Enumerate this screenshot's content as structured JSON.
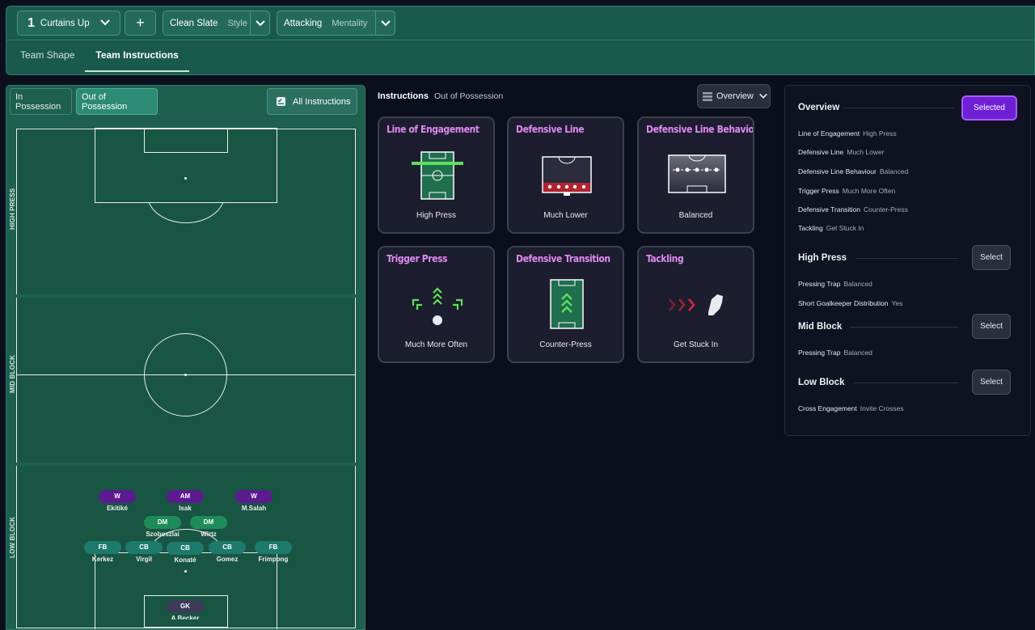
{
  "header": {
    "tactic_number": "1",
    "tactic_name": "Curtains Up",
    "add_label": "+",
    "style": {
      "value": "Clean Slate",
      "label": "Style"
    },
    "mentality": {
      "value": "Attacking",
      "label": "Mentality"
    },
    "tabs": [
      {
        "label": "Team Shape"
      },
      {
        "label": "Team Instructions"
      }
    ]
  },
  "pitch_panel": {
    "toggle_in": "In Possession",
    "toggle_out": "Out of Possession",
    "all_instructions": "All Instructions",
    "zones": [
      "HIGH PRESS",
      "MID BLOCK",
      "LOW BLOCK"
    ],
    "players": [
      {
        "pos": "W",
        "name": "Ekitiké"
      },
      {
        "pos": "AM",
        "name": "Isak"
      },
      {
        "pos": "W",
        "name": "M.Salah"
      },
      {
        "pos": "DM",
        "name": "Szoboszlai"
      },
      {
        "pos": "DM",
        "name": "Wirtz"
      },
      {
        "pos": "FB",
        "name": "Kerkez"
      },
      {
        "pos": "CB",
        "name": "Virgil"
      },
      {
        "pos": "CB",
        "name": "Konaté"
      },
      {
        "pos": "CB",
        "name": "Gomez"
      },
      {
        "pos": "FB",
        "name": "Frimpong"
      },
      {
        "pos": "GK",
        "name": "A.Becker"
      }
    ]
  },
  "instructions": {
    "title": "Instructions",
    "subtitle": "Out of Possession",
    "view_select": "Overview",
    "cards": [
      {
        "title": "Line of Engagement",
        "value": "High Press"
      },
      {
        "title": "Defensive Line",
        "value": "Much Lower"
      },
      {
        "title": "Defensive Line Behavio",
        "value": "Balanced"
      },
      {
        "title": "Trigger Press",
        "value": "Much More Often"
      },
      {
        "title": "Defensive Transition",
        "value": "Counter-Press"
      },
      {
        "title": "Tackling",
        "value": "Get Stuck In"
      }
    ]
  },
  "overview": {
    "title": "Overview",
    "selected_label": "Selected",
    "items": [
      {
        "label": "Line of Engagement",
        "value": "High Press"
      },
      {
        "label": "Defensive Line",
        "value": "Much Lower"
      },
      {
        "label": "Defensive Line Behaviour",
        "value": "Balanced"
      },
      {
        "label": "Trigger Press",
        "value": "Much More Often"
      },
      {
        "label": "Defensive Transition",
        "value": "Counter-Press"
      },
      {
        "label": "Tackling",
        "value": "Get Stuck In"
      }
    ],
    "sections": [
      {
        "title": "High Press",
        "button": "Select",
        "items": [
          {
            "label": "Pressing Trap",
            "value": "Balanced"
          },
          {
            "label": "Short Goalkeeper Distribution",
            "value": "Yes"
          }
        ]
      },
      {
        "title": "Mid Block",
        "button": "Select",
        "items": [
          {
            "label": "Pressing Trap",
            "value": "Balanced"
          }
        ]
      },
      {
        "title": "Low Block",
        "button": "Select",
        "items": [
          {
            "label": "Cross Engagement",
            "value": "Invite Crosses"
          }
        ]
      }
    ]
  },
  "colors": {
    "accent_purple": "#e089f2",
    "selected_button": "#6f1fd6",
    "pitch_green": "#195543",
    "attacker_pill": "#5c1b8f",
    "midfield_pill": "#1e8c5a",
    "defender_pill": "#1d7a6c",
    "gk_pill": "#3e3a5a"
  }
}
